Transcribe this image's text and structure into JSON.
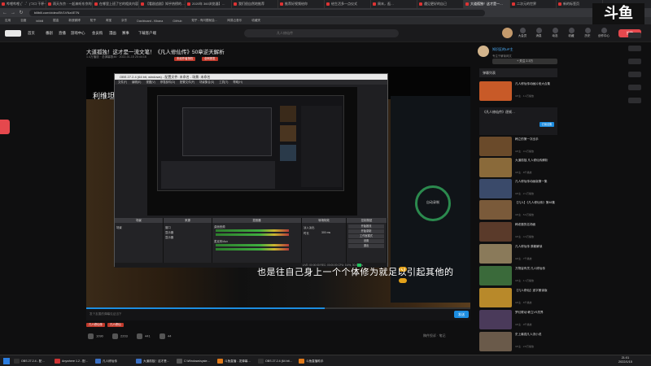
{
  "browser": {
    "tabs": [
      {
        "label": "哔哩哔哩 (゜-゜)つロ 干杯~-bili"
      },
      {
        "label": "雨天东京 · 一起来听东京的雨"
      },
      {
        "label": "在哪里上班了它的相关内容"
      },
      {
        "label": "【看剧追剧】知乎热榜的…"
      },
      {
        "label": "2020年 360浏览器】…"
      },
      {
        "label": "我们很自然地推荐"
      },
      {
        "label": "推荐好视频给你"
      },
      {
        "label": "给生活多一点仪式"
      },
      {
        "label": "周末，逛…"
      },
      {
        "label": "遇见更好的自己"
      },
      {
        "label": "大道孤独！这才是一…"
      },
      {
        "label": "二次元的世界"
      },
      {
        "label": "新的标签页"
      }
    ],
    "url": "bilibili.com/video/BV1VNz4E7N",
    "bookmarks": [
      "应用",
      "百度",
      "bilibili",
      "掘金",
      "新浪微博",
      "知乎",
      "淘宝",
      "京东",
      "Dashboard - Kibana",
      "GitHub",
      "知乎 - 有问题就会…",
      "网易云音乐",
      "收藏夹"
    ]
  },
  "site": {
    "nav": [
      "首页",
      "番剧",
      "直播",
      "游戏中心",
      "会员购",
      "漫画",
      "赛事",
      "下载客户端"
    ],
    "search_placeholder": "凡人修仙传",
    "right_icons": [
      "大会员",
      "消息",
      "动态",
      "收藏",
      "历史",
      "创作中心"
    ],
    "upload_label": "投稿"
  },
  "video": {
    "title": "大道孤独！这才是一流文笔！《凡人修仙传》50章逆天解析",
    "meta": "1.4万播放 · 总弹幕数46 · 2022-01-15 20:44:16",
    "tags": [
      "未经作者授权",
      "全网首发"
    ],
    "subtitle_top": "利维坦",
    "subtitle_bottom": "也是往自己身上一个个体修为就足以引起其他的",
    "danmu_placeholder": "发个友善的弹幕见证当下",
    "send_label": "发送",
    "progress": 0.62,
    "stats": [
      {
        "icon": "like-icon",
        "value": "1090"
      },
      {
        "icon": "coin-icon",
        "value": "2203"
      },
      {
        "icon": "star-icon",
        "value": "441"
      },
      {
        "icon": "share-icon",
        "value": "44"
      }
    ],
    "bottom_tags": [
      "凡人修仙传",
      "凡人修仙"
    ],
    "report": "稿件投诉 · 笔记"
  },
  "obs": {
    "title": "OBS 27.2.4 (64 bit, windows) - 配置文件: 未命名 - 场景: 未命名",
    "menu": [
      "文件(F)",
      "编辑(E)",
      "视图(V)",
      "停靠部件(D)",
      "配置文件(P)",
      "场景集合(S)",
      "工具(T)",
      "帮助(H)"
    ],
    "docks": [
      "场景",
      "来源",
      "混音器",
      "转场特效",
      "控制按钮"
    ],
    "scenes": [
      "场景"
    ],
    "sources": [
      "窗口",
      "显示器",
      "显示器"
    ],
    "mixer": [
      "桌面音频",
      "麦克风/Aux"
    ],
    "transition": [
      "淡入淡出",
      "时长",
      "300 ms"
    ],
    "controls": [
      "开始推流",
      "开始录制",
      "工作室模式",
      "设置",
      "退出"
    ],
    "status": "LIVE: 00:00:00  REC: 00:00:00  CPU: 0.4%, 30.00 fps"
  },
  "app": {
    "ring_label": "自动录制"
  },
  "sidebar": {
    "up_name": "知识区的UP主",
    "up_desc": "专注于解读网文",
    "follow_label": "+ 关注 2.3万",
    "danmu_list_label": "弹幕列表",
    "collection_title": "《凡人修仙传》逐帧…",
    "collection_btn": "订阅合集",
    "recs": [
      {
        "title": "凡人修仙传动画片段大合集",
        "meta": "UP主 · 1.2万播放"
      },
      {
        "title": "韩立的第一次出手",
        "meta": "UP主 · 3.4万播放"
      },
      {
        "title": "大道孤独 凡人修仙传解析",
        "meta": "UP主 · 8千播放"
      },
      {
        "title": "凡人修仙传动画版第一集",
        "meta": "UP主 · 2.1万播放"
      },
      {
        "title": "【凡人】《凡人修仙传》第48集",
        "meta": "UP主 · 5.6万播放"
      },
      {
        "title": "韩老魔的名场面",
        "meta": "UP主 · 4.3万播放"
      },
      {
        "title": "凡人修仙传 原著解读",
        "meta": "UP主 · 7千播放"
      },
      {
        "title": "万物皆有灵 凡人修仙传",
        "meta": "UP主 · 1.1万播放"
      },
      {
        "title": "【凡人修仙】逐字朗读版",
        "meta": "UP主 · 6千播放"
      },
      {
        "title": "梦幻联动 韩立VS灵界",
        "meta": "UP主 · 9千播放"
      },
      {
        "title": "史上最强凡人流小说",
        "meta": "UP主 · 2.8万播放"
      }
    ]
  },
  "right": {
    "logo": "斗鱼"
  },
  "taskbar": {
    "items": [
      "OBS 27.2.4 - 配…",
      "Anywhere 1.2 - 配…",
      "凡人修仙传",
      "大道孤独！这才是…",
      "C:\\Windows\\syste…",
      "斗鱼直播 - 发弹幕…",
      "OBS 27.2.4 (64 bit…",
      "斗鱼直播助手"
    ],
    "time": "21:01",
    "date": "2022/1/15"
  }
}
